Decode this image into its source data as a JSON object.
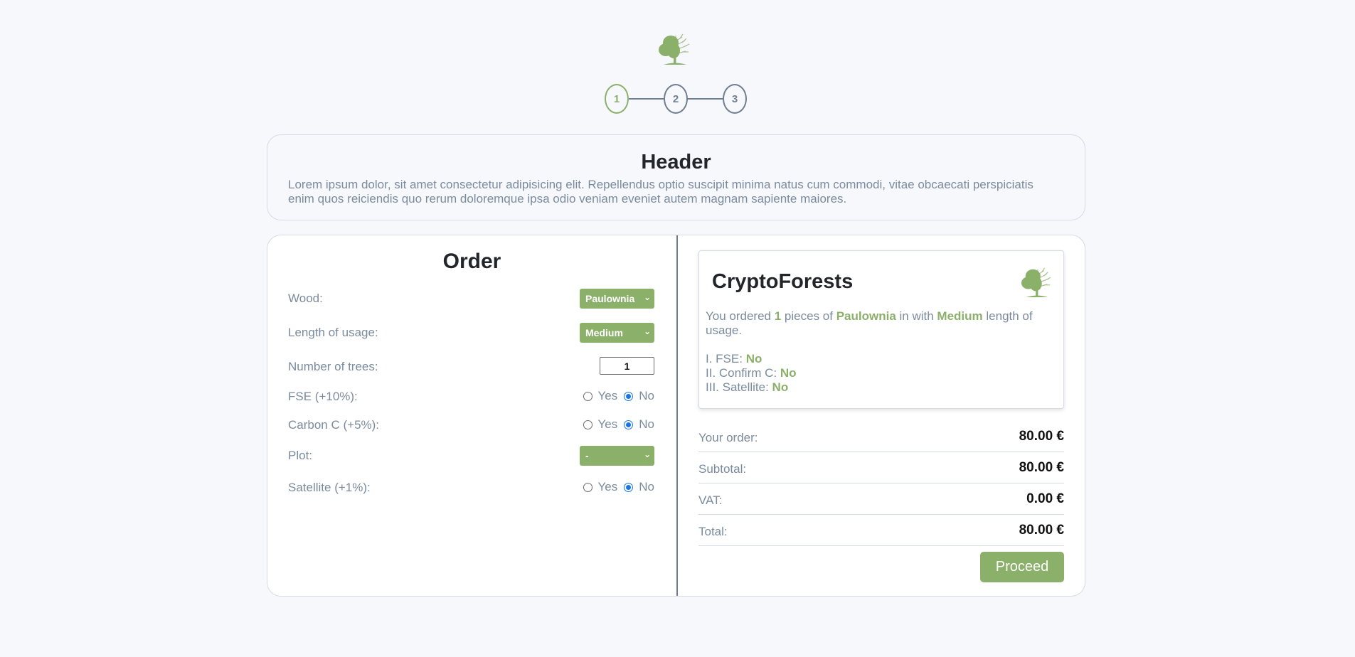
{
  "stepper": {
    "steps": [
      "1",
      "2",
      "3"
    ],
    "active_step": "1"
  },
  "header": {
    "title": "Header",
    "description": "Lorem ipsum dolor, sit amet consectetur adipisicing elit. Repellendus optio suscipit minima natus cum commodi, vitae obcaecati perspiciatis enim quos reiciendis quo rerum doloremque ipsa odio veniam eveniet autem magnam sapiente maiores."
  },
  "order": {
    "title": "Order",
    "wood": {
      "label": "Wood:",
      "value": "Paulownia"
    },
    "length": {
      "label": "Length of usage:",
      "value": "Medium"
    },
    "trees": {
      "label": "Number of trees:",
      "value": "1"
    },
    "fse": {
      "label": "FSE (+10%):",
      "yes": "Yes",
      "no": "No",
      "selected": "No"
    },
    "carbon": {
      "label": "Carbon C (+5%):",
      "yes": "Yes",
      "no": "No",
      "selected": "No"
    },
    "plot": {
      "label": "Plot:",
      "value": "-"
    },
    "satellite": {
      "label": "Satellite (+1%):",
      "yes": "Yes",
      "no": "No",
      "selected": "No"
    }
  },
  "summary": {
    "brand": "CryptoForests",
    "text_1": "You ordered ",
    "count": "1",
    "text_2": " pieces of ",
    "wood": "Paulownia",
    "text_3": " in with ",
    "length": "Medium",
    "text_4": " length of usage.",
    "fse_label": "I. FSE: ",
    "fse_value": "No",
    "confirm_label": "II. Confirm C: ",
    "confirm_value": "No",
    "satellite_label": "III. Satellite: ",
    "satellite_value": "No"
  },
  "totals": {
    "your_order_label": "Your order:",
    "your_order_value": "80.00 €",
    "subtotal_label": "Subtotal:",
    "subtotal_value": "80.00 €",
    "vat_label": "VAT:",
    "vat_value": "0.00 €",
    "total_label": "Total:",
    "total_value": "80.00 €"
  },
  "proceed_label": "Proceed",
  "icons": {
    "logo": "tree-logo-icon",
    "select_chevron": "chevron-down-icon"
  },
  "colors": {
    "accent_green": "#8bb06a",
    "slate": "#6f7e91",
    "text_muted": "#7b8b9e",
    "radio_blue": "#1a73e8",
    "background": "#f7f8fc"
  }
}
